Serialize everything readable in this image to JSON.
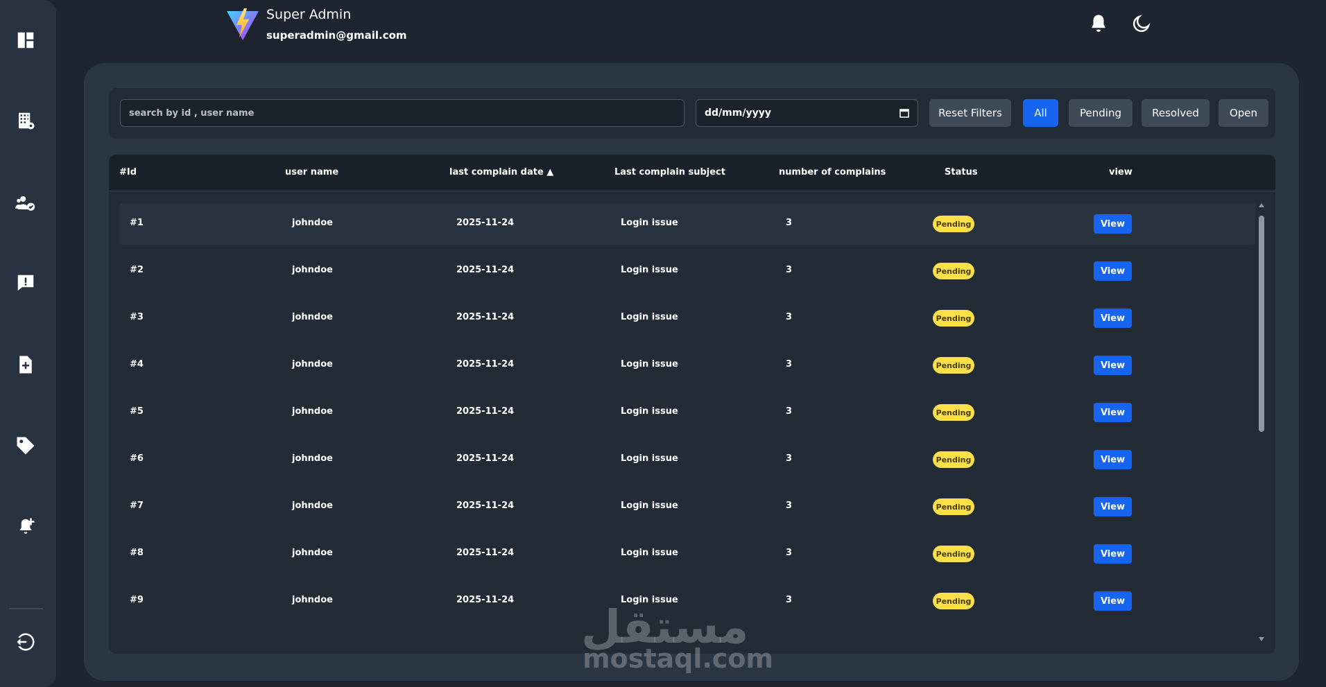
{
  "header": {
    "name": "Super Admin",
    "email": "superadmin@gmail.com"
  },
  "sidebar": {
    "icons": [
      "dashboard-icon",
      "buildings-icon",
      "users-icon",
      "complaints-icon",
      "file-add-icon",
      "tag-icon",
      "notification-add-icon",
      "logout-icon"
    ]
  },
  "filters": {
    "search_placeholder": "search by id , user name",
    "date_placeholder": "dd/mm/yyyy",
    "reset_label": "Reset Filters",
    "tabs": [
      {
        "label": "All",
        "active": true
      },
      {
        "label": "Pending",
        "active": false
      },
      {
        "label": "Resolved",
        "active": false
      },
      {
        "label": "Open",
        "active": false
      }
    ]
  },
  "table": {
    "columns": [
      "#Id",
      "user name",
      "last complain date ▲",
      "Last complain subject",
      "number of complains",
      "Status",
      "view"
    ],
    "rows": [
      {
        "id": "#1",
        "user": "johndoe",
        "date": "2025-11-24",
        "subject": "Login issue",
        "count": "3",
        "status": "Pending",
        "action": "View"
      },
      {
        "id": "#2",
        "user": "johndoe",
        "date": "2025-11-24",
        "subject": "Login issue",
        "count": "3",
        "status": "Pending",
        "action": "View"
      },
      {
        "id": "#3",
        "user": "johndoe",
        "date": "2025-11-24",
        "subject": "Login issue",
        "count": "3",
        "status": "Pending",
        "action": "View"
      },
      {
        "id": "#4",
        "user": "johndoe",
        "date": "2025-11-24",
        "subject": "Login issue",
        "count": "3",
        "status": "Pending",
        "action": "View"
      },
      {
        "id": "#5",
        "user": "johndoe",
        "date": "2025-11-24",
        "subject": "Login issue",
        "count": "3",
        "status": "Pending",
        "action": "View"
      },
      {
        "id": "#6",
        "user": "johndoe",
        "date": "2025-11-24",
        "subject": "Login issue",
        "count": "3",
        "status": "Pending",
        "action": "View"
      },
      {
        "id": "#7",
        "user": "johndoe",
        "date": "2025-11-24",
        "subject": "Login issue",
        "count": "3",
        "status": "Pending",
        "action": "View"
      },
      {
        "id": "#8",
        "user": "johndoe",
        "date": "2025-11-24",
        "subject": "Login issue",
        "count": "3",
        "status": "Pending",
        "action": "View"
      },
      {
        "id": "#9",
        "user": "johndoe",
        "date": "2025-11-24",
        "subject": "Login issue",
        "count": "3",
        "status": "Pending",
        "action": "View"
      }
    ]
  },
  "watermark": {
    "arabic": "مستقل",
    "latin": "mostaql.com"
  },
  "colors": {
    "accent": "#1565f0",
    "pending": "#fde047",
    "panel": "#2b3645",
    "background": "#1e2530"
  }
}
